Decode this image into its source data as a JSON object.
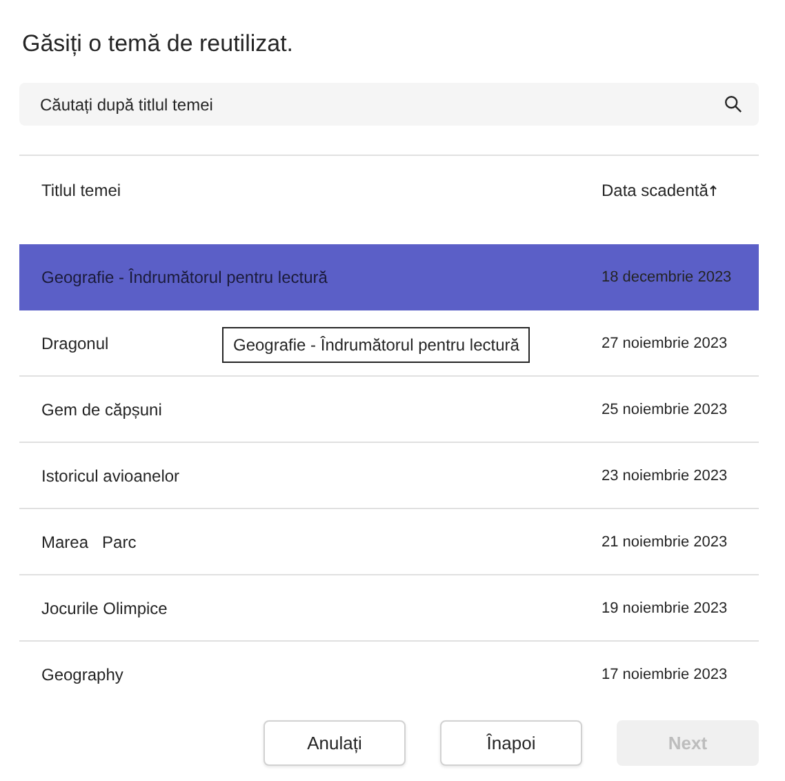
{
  "title": "Găsiți o temă de reutilizat.",
  "search": {
    "placeholder": "Căutați după titlul temei"
  },
  "table": {
    "columns": [
      "Titlul temei",
      "Data scadentă"
    ],
    "rows": [
      {
        "title": "Geografie - Îndrumătorul pentru lectură",
        "due": "18 decembrie 2023",
        "selected": true
      },
      {
        "title": "Dragonul",
        "due": "27 noiembrie 2023",
        "selected": false
      },
      {
        "title": "Gem de căpșuni",
        "due": "25 noiembrie 2023",
        "selected": false
      },
      {
        "title": "Istoricul avioanelor",
        "due": "23 noiembrie 2023",
        "selected": false
      },
      {
        "title": "Marea   Parc",
        "due": "21 noiembrie 2023",
        "selected": false
      },
      {
        "title": "Jocurile Olimpice",
        "due": "19 noiembrie 2023",
        "selected": false
      },
      {
        "title": "Geography",
        "due": "17 noiembrie 2023",
        "selected": false
      }
    ]
  },
  "tooltip": "Geografie - Îndrumătorul pentru lectură",
  "buttons": [
    {
      "label": "Anulați",
      "disabled": false
    },
    {
      "label": "Înapoi",
      "disabled": false
    },
    {
      "label": "Next",
      "disabled": true
    }
  ]
}
